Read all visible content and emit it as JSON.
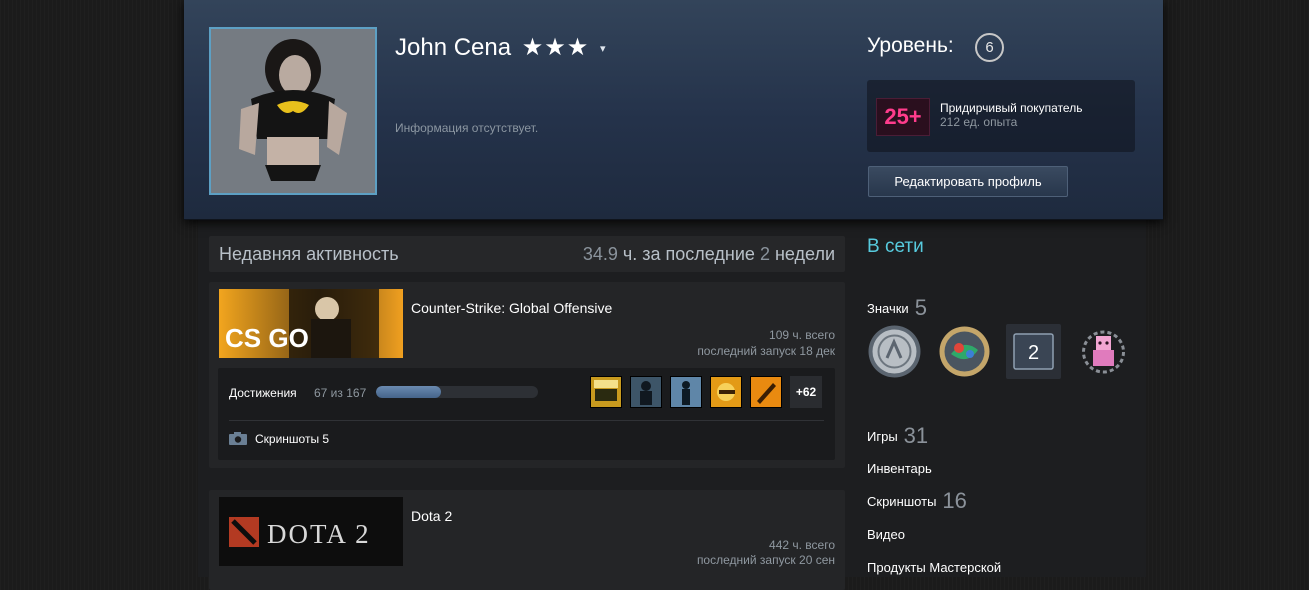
{
  "profile": {
    "name": "John Cena",
    "stars": "★★★",
    "caret": "▾",
    "summary": "Информация отсутствует.",
    "level_label": "Уровень:",
    "level": "6",
    "favorite_badge": {
      "icon_text": "25+",
      "title": "Придирчивый покупатель",
      "xp": "212 ед. опыта"
    },
    "edit_button": "Редактировать профиль"
  },
  "activity": {
    "title": "Недавняя активность",
    "hours": "34.9",
    "hours_unit": "ч. за последние",
    "weeks": "2",
    "weeks_unit": "недели",
    "games": [
      {
        "name": "Counter-Strike: Global Offensive",
        "hours_total": "109 ч. всего",
        "last_played": "последний запуск 18 дек",
        "achievements_label": "Достижения",
        "achievements_progress": "67 из 167",
        "achievements_fraction": 0.4,
        "achievements_more": "+62",
        "screenshots_label": "Скриншоты 5"
      },
      {
        "name": "Dota 2",
        "hours_total": "442 ч. всего",
        "last_played": "последний запуск 20 сен"
      }
    ]
  },
  "sidebar": {
    "status": "В сети",
    "badges_label": "Значки",
    "badges_count": "5",
    "badge_level_number": "2",
    "games_label": "Игры",
    "games_count": "31",
    "inventory_label": "Инвентарь",
    "screenshots_label": "Скриншоты",
    "screenshots_count": "16",
    "videos_label": "Видео",
    "workshop_label": "Продукты Мастерской"
  },
  "capsules": {
    "cs_logo": "CS GO",
    "dota_logo": "DOTA 2"
  },
  "colors": {
    "accent": "#57cbde",
    "header_bg": "#2b3a52",
    "badge_pink": "#ff3c8c",
    "cs_orange": "#f0a020"
  }
}
